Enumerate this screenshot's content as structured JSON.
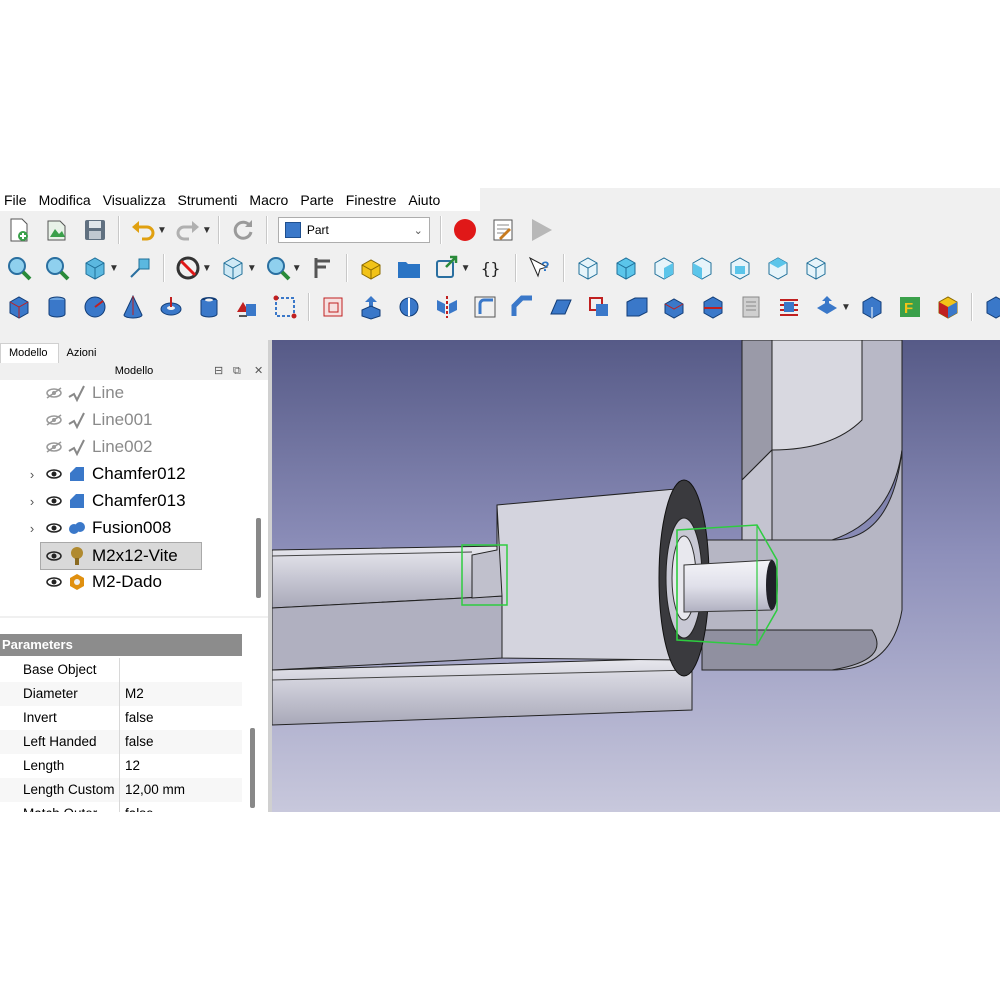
{
  "menu": [
    "File",
    "Modifica",
    "Visualizza",
    "Strumenti",
    "Macro",
    "Parte",
    "Finestre",
    "Aiuto"
  ],
  "workbench": {
    "selected": "Part"
  },
  "tabs": [
    "Modello",
    "Azioni"
  ],
  "panel": {
    "title": "Modello"
  },
  "tree": [
    {
      "label": "Line",
      "visible": false,
      "expandable": false,
      "icon": "sketch-line-icon"
    },
    {
      "label": "Line001",
      "visible": false,
      "expandable": false,
      "icon": "sketch-line-icon"
    },
    {
      "label": "Line002",
      "visible": false,
      "expandable": false,
      "icon": "sketch-line-icon"
    },
    {
      "label": "Chamfer012",
      "visible": true,
      "expandable": true,
      "icon": "chamfer-icon"
    },
    {
      "label": "Chamfer013",
      "visible": true,
      "expandable": true,
      "icon": "chamfer-icon"
    },
    {
      "label": "Fusion008",
      "visible": true,
      "expandable": true,
      "icon": "fusion-icon"
    },
    {
      "label": "M2x12-Vite",
      "visible": true,
      "expandable": false,
      "selected": true,
      "icon": "screw-icon"
    },
    {
      "label": "M2-Dado",
      "visible": true,
      "expandable": false,
      "icon": "nut-icon"
    }
  ],
  "properties": {
    "group": "Parameters",
    "rows": [
      {
        "name": "Base Object",
        "value": ""
      },
      {
        "name": "Diameter",
        "value": "M2"
      },
      {
        "name": "Invert",
        "value": "false"
      },
      {
        "name": "Left Handed",
        "value": "false"
      },
      {
        "name": "Length",
        "value": "12"
      },
      {
        "name": "Length Custom",
        "value": "12,00 mm"
      },
      {
        "name": "Match Outer",
        "value": "false"
      }
    ]
  },
  "colors": {
    "viewport_top": "#565a87",
    "viewport_bottom": "#c8c8dc",
    "selection_green": "#2ecc40",
    "part_blue": "#3a78c9"
  }
}
